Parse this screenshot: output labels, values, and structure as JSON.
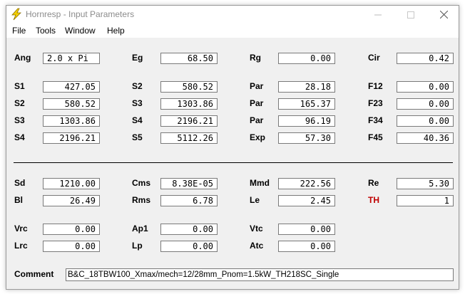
{
  "window": {
    "title": "Hornresp - Input Parameters"
  },
  "menu": {
    "file": "File",
    "tools": "Tools",
    "window": "Window",
    "help": "Help"
  },
  "icons": {
    "app": "lightning-bolt-icon",
    "minimize": "minimize-icon",
    "maximize": "maximize-icon",
    "close": "close-icon"
  },
  "colors": {
    "th_label": "#c00000",
    "app_icon": "#f4d000"
  },
  "fields": {
    "ang": {
      "label": "Ang",
      "value": "2.0 x Pi"
    },
    "eg": {
      "label": "Eg",
      "value": "68.50"
    },
    "rg": {
      "label": "Rg",
      "value": "0.00"
    },
    "cir": {
      "label": "Cir",
      "value": "0.42"
    },
    "s1": {
      "label": "S1",
      "value": "427.05"
    },
    "s2_b": {
      "label": "S2",
      "value": "580.52"
    },
    "par1": {
      "label": "Par",
      "value": "28.18"
    },
    "f12": {
      "label": "F12",
      "value": "0.00"
    },
    "s2": {
      "label": "S2",
      "value": "580.52"
    },
    "s3_b": {
      "label": "S3",
      "value": "1303.86"
    },
    "par2": {
      "label": "Par",
      "value": "165.37"
    },
    "f23": {
      "label": "F23",
      "value": "0.00"
    },
    "s3": {
      "label": "S3",
      "value": "1303.86"
    },
    "s4_b": {
      "label": "S4",
      "value": "2196.21"
    },
    "par3": {
      "label": "Par",
      "value": "96.19"
    },
    "f34": {
      "label": "F34",
      "value": "0.00"
    },
    "s4": {
      "label": "S4",
      "value": "2196.21"
    },
    "s5": {
      "label": "S5",
      "value": "5112.26"
    },
    "exp": {
      "label": "Exp",
      "value": "57.30"
    },
    "f45": {
      "label": "F45",
      "value": "40.36"
    },
    "sd": {
      "label": "Sd",
      "value": "1210.00"
    },
    "cms": {
      "label": "Cms",
      "value": "8.38E-05"
    },
    "mmd": {
      "label": "Mmd",
      "value": "222.56"
    },
    "re": {
      "label": "Re",
      "value": "5.30"
    },
    "bl": {
      "label": "Bl",
      "value": "26.49"
    },
    "rms": {
      "label": "Rms",
      "value": "6.78"
    },
    "le": {
      "label": "Le",
      "value": "2.45"
    },
    "th": {
      "label": "TH",
      "value": "1"
    },
    "vrc": {
      "label": "Vrc",
      "value": "0.00"
    },
    "ap1": {
      "label": "Ap1",
      "value": "0.00"
    },
    "vtc": {
      "label": "Vtc",
      "value": "0.00"
    },
    "lrc": {
      "label": "Lrc",
      "value": "0.00"
    },
    "lp": {
      "label": "Lp",
      "value": "0.00"
    },
    "atc": {
      "label": "Atc",
      "value": "0.00"
    }
  },
  "comment": {
    "label": "Comment",
    "value": "B&C_18TBW100_Xmax/mech=12/28mm_Pnom=1.5kW_TH218SC_Single"
  }
}
